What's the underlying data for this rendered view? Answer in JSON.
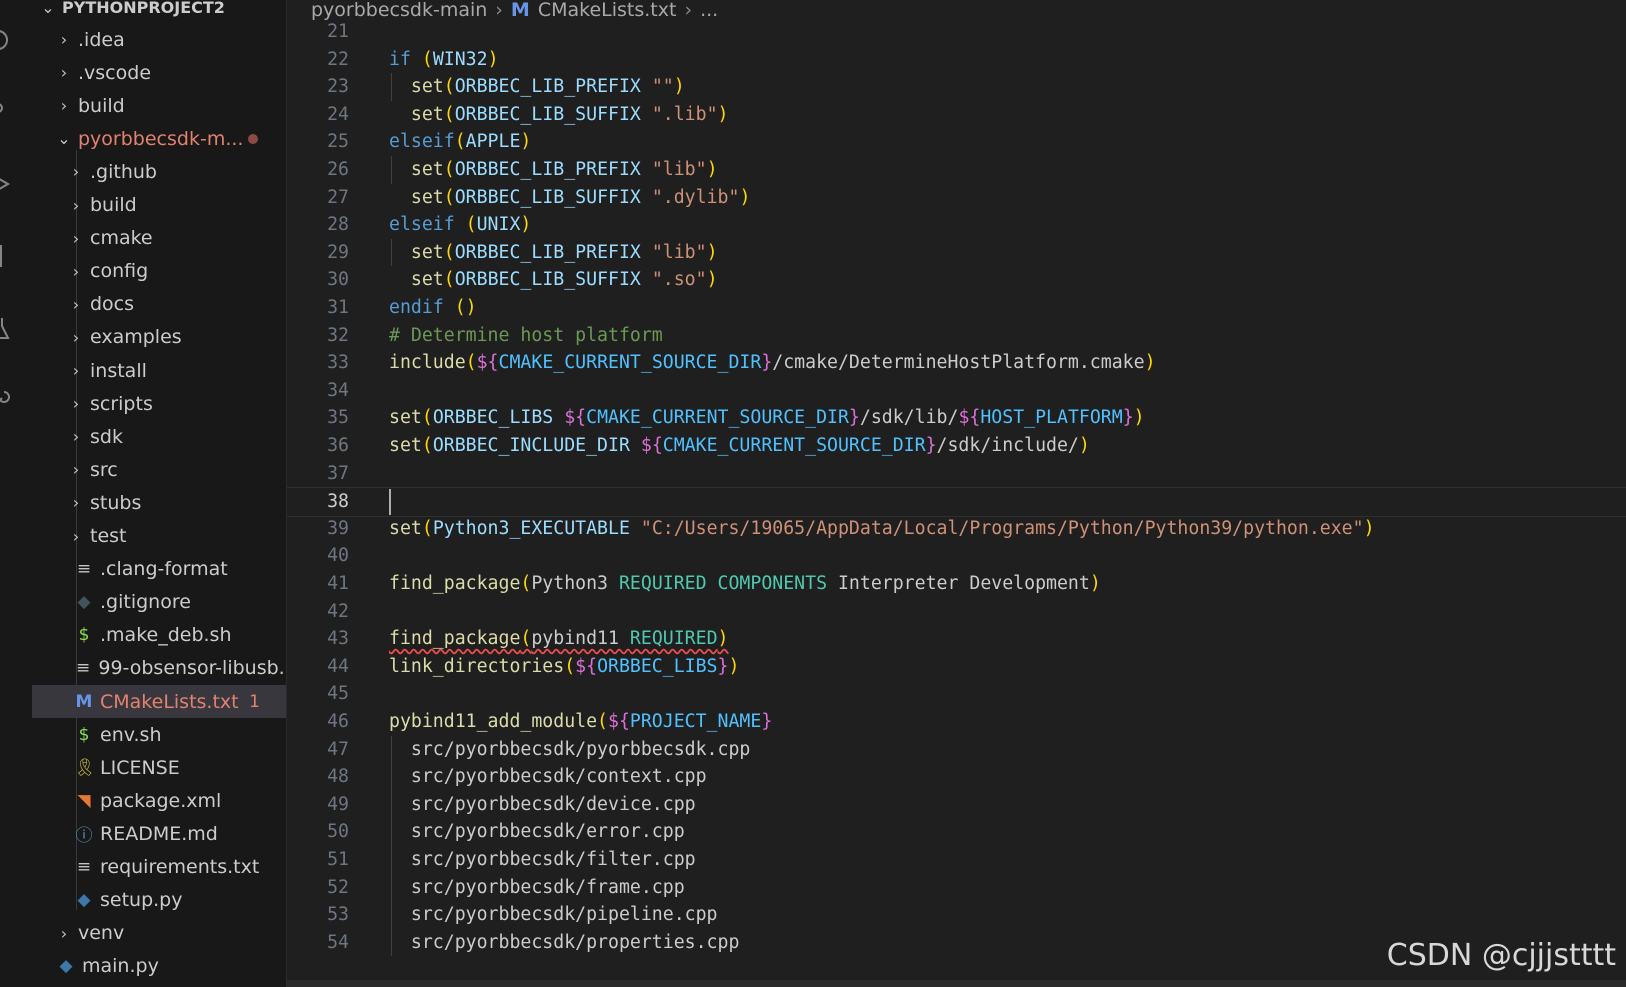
{
  "explorer": {
    "root_label": "PYTHONPROJECT2",
    "items": [
      {
        "label": ".idea",
        "kind": "folder"
      },
      {
        "label": ".vscode",
        "kind": "folder"
      },
      {
        "label": "build",
        "kind": "folder"
      },
      {
        "label": "pyorbbecsdk-m...",
        "kind": "folder-open"
      },
      {
        "label": ".github",
        "kind": "folder"
      },
      {
        "label": "build",
        "kind": "folder"
      },
      {
        "label": "cmake",
        "kind": "folder"
      },
      {
        "label": "config",
        "kind": "folder"
      },
      {
        "label": "docs",
        "kind": "folder"
      },
      {
        "label": "examples",
        "kind": "folder"
      },
      {
        "label": "install",
        "kind": "folder"
      },
      {
        "label": "scripts",
        "kind": "folder"
      },
      {
        "label": "sdk",
        "kind": "folder"
      },
      {
        "label": "src",
        "kind": "folder"
      },
      {
        "label": "stubs",
        "kind": "folder"
      },
      {
        "label": "test",
        "kind": "folder"
      },
      {
        "label": ".clang-format",
        "kind": "file",
        "icon": "lines-icon"
      },
      {
        "label": ".gitignore",
        "kind": "file",
        "icon": "git-icon"
      },
      {
        "label": ".make_deb.sh",
        "kind": "file",
        "icon": "shell-icon"
      },
      {
        "label": "99-obsensor-libusb....",
        "kind": "file",
        "icon": "lines-icon"
      },
      {
        "label": "CMakeLists.txt",
        "kind": "file",
        "icon": "cmake-icon",
        "badge": "1"
      },
      {
        "label": "env.sh",
        "kind": "file",
        "icon": "shell-icon"
      },
      {
        "label": "LICENSE",
        "kind": "file",
        "icon": "license-icon"
      },
      {
        "label": "package.xml",
        "kind": "file",
        "icon": "rss-icon"
      },
      {
        "label": "README.md",
        "kind": "file",
        "icon": "info-icon"
      },
      {
        "label": "requirements.txt",
        "kind": "file",
        "icon": "lines-icon"
      },
      {
        "label": "setup.py",
        "kind": "file",
        "icon": "python-icon"
      },
      {
        "label": "venv",
        "kind": "folder"
      },
      {
        "label": "main.py",
        "kind": "file",
        "icon": "python-icon"
      }
    ],
    "colors": {
      "modified": "#e2826f",
      "selected_bg": "#37373d"
    }
  },
  "breadcrumb": {
    "folder": "pyorbbecsdk-main",
    "file_icon": "M",
    "file": "CMakeLists.txt",
    "tail": "..."
  },
  "editor": {
    "current_line": "38",
    "lines": [
      {
        "n": "21",
        "text": ""
      },
      {
        "n": "22",
        "text": "if (WIN32)"
      },
      {
        "n": "23",
        "text": "  set(ORBBEC_LIB_PREFIX \"\")"
      },
      {
        "n": "24",
        "text": "  set(ORBBEC_LIB_SUFFIX \".lib\")"
      },
      {
        "n": "25",
        "text": "elseif(APPLE)"
      },
      {
        "n": "26",
        "text": "  set(ORBBEC_LIB_PREFIX \"lib\")"
      },
      {
        "n": "27",
        "text": "  set(ORBBEC_LIB_SUFFIX \".dylib\")"
      },
      {
        "n": "28",
        "text": "elseif (UNIX)"
      },
      {
        "n": "29",
        "text": "  set(ORBBEC_LIB_PREFIX \"lib\")"
      },
      {
        "n": "30",
        "text": "  set(ORBBEC_LIB_SUFFIX \".so\")"
      },
      {
        "n": "31",
        "text": "endif ()"
      },
      {
        "n": "32",
        "text": "# Determine host platform"
      },
      {
        "n": "33",
        "text": "include(${CMAKE_CURRENT_SOURCE_DIR}/cmake/DetermineHostPlatform.cmake)"
      },
      {
        "n": "34",
        "text": ""
      },
      {
        "n": "35",
        "text": "set(ORBBEC_LIBS ${CMAKE_CURRENT_SOURCE_DIR}/sdk/lib/${HOST_PLATFORM})"
      },
      {
        "n": "36",
        "text": "set(ORBBEC_INCLUDE_DIR ${CMAKE_CURRENT_SOURCE_DIR}/sdk/include/)"
      },
      {
        "n": "37",
        "text": ""
      },
      {
        "n": "38",
        "text": ""
      },
      {
        "n": "39",
        "text": "set(Python3_EXECUTABLE \"C:/Users/19065/AppData/Local/Programs/Python/Python39/python.exe\")"
      },
      {
        "n": "40",
        "text": ""
      },
      {
        "n": "41",
        "text": "find_package(Python3 REQUIRED COMPONENTS Interpreter Development)"
      },
      {
        "n": "42",
        "text": ""
      },
      {
        "n": "43",
        "text": "find_package(pybind11 REQUIRED)"
      },
      {
        "n": "44",
        "text": "link_directories(${ORBBEC_LIBS})"
      },
      {
        "n": "45",
        "text": ""
      },
      {
        "n": "46",
        "text": "pybind11_add_module(${PROJECT_NAME}"
      },
      {
        "n": "47",
        "text": "  src/pyorbbecsdk/pyorbbecsdk.cpp"
      },
      {
        "n": "48",
        "text": "  src/pyorbbecsdk/context.cpp"
      },
      {
        "n": "49",
        "text": "  src/pyorbbecsdk/device.cpp"
      },
      {
        "n": "50",
        "text": "  src/pyorbbecsdk/error.cpp"
      },
      {
        "n": "51",
        "text": "  src/pyorbbecsdk/filter.cpp"
      },
      {
        "n": "52",
        "text": "  src/pyorbbecsdk/frame.cpp"
      },
      {
        "n": "53",
        "text": "  src/pyorbbecsdk/pipeline.cpp"
      },
      {
        "n": "54",
        "text": "  src/pyorbbecsdk/properties.cpp"
      }
    ]
  },
  "watermark": "CSDN @cjjjstttt"
}
